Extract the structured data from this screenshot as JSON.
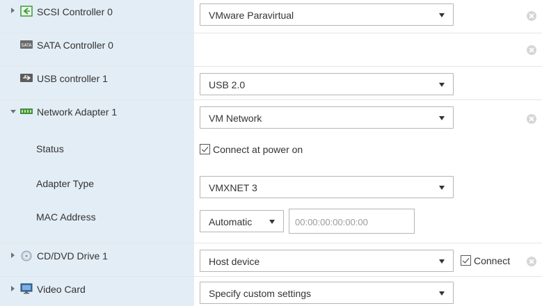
{
  "rows": {
    "scsi": {
      "label": "SCSI Controller 0",
      "value": "VMware Paravirtual"
    },
    "sata": {
      "label": "SATA Controller 0",
      "icon_text": "SATA"
    },
    "usb": {
      "label": "USB controller 1",
      "value": "USB 2.0"
    },
    "network": {
      "label": "Network Adapter 1",
      "value": "VM Network"
    },
    "status": {
      "label": "Status",
      "checkbox_label": "Connect at power on",
      "checked": true
    },
    "adapter_type": {
      "label": "Adapter Type",
      "value": "VMXNET 3"
    },
    "mac": {
      "label": "MAC Address",
      "mode": "Automatic",
      "placeholder": "00:00:00:00:00:00"
    },
    "cddvd": {
      "label": "CD/DVD Drive 1",
      "value": "Host device",
      "connect_label": "Connect",
      "connect_checked": true
    },
    "video": {
      "label": "Video Card",
      "value": "Specify custom settings"
    }
  },
  "colors": {
    "label_bg": "#e3edf5",
    "accent_green": "#4caf50",
    "remove_icon": "#d6d6d6"
  }
}
